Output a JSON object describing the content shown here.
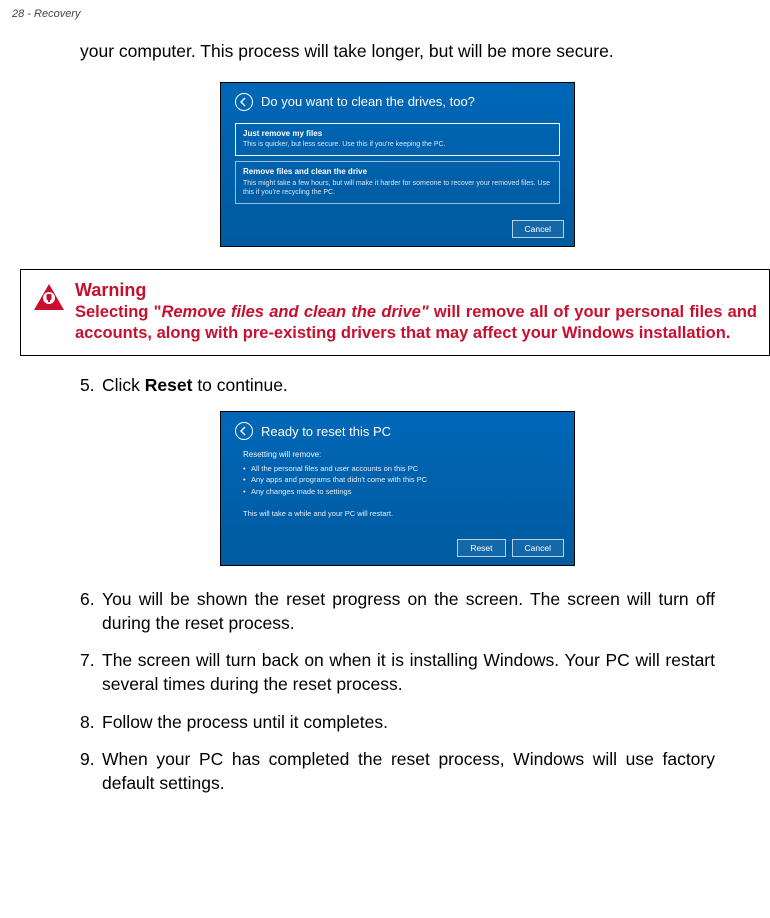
{
  "header": "28 - Recovery",
  "intro": "your computer. This process will take longer, but will be more secure.",
  "dialog1": {
    "title": "Do you want to clean the drives, too?",
    "options": [
      {
        "title": "Just remove my files",
        "desc": "This is quicker, but less secure. Use this if you're keeping the PC."
      },
      {
        "title": "Remove files and clean the drive",
        "desc": "This might take a few hours, but will make it harder for someone to recover your removed files. Use this if you're recycling the PC."
      }
    ],
    "cancel": "Cancel"
  },
  "warning": {
    "title": "Warning",
    "prefix": "Selecting \"",
    "italic": "Remove files and clean the drive\"",
    "suffix": " will remove all of your personal files and accounts, along with pre-existing drivers that may affect your Windows installation."
  },
  "step5": {
    "num": "5.",
    "pre": "Click ",
    "bold": "Reset",
    "post": " to continue."
  },
  "dialog2": {
    "title": "Ready to reset this PC",
    "intro": "Resetting will remove:",
    "bullets": [
      "All the personal files and user accounts on this PC",
      "Any apps and programs that didn't come with this PC",
      "Any changes made to settings"
    ],
    "note": "This will take a while and your PC will restart.",
    "reset": "Reset",
    "cancel": "Cancel"
  },
  "steps": [
    {
      "num": "6.",
      "text": "You will be shown the reset progress on the screen. The screen will turn off during the reset process."
    },
    {
      "num": "7.",
      "text": "The screen will turn back on when it is installing Windows. Your PC will restart several times during the reset process."
    },
    {
      "num": "8.",
      "text": "Follow the process until it completes."
    },
    {
      "num": "9.",
      "text": "When your PC has completed the reset process, Windows will use factory default settings."
    }
  ]
}
